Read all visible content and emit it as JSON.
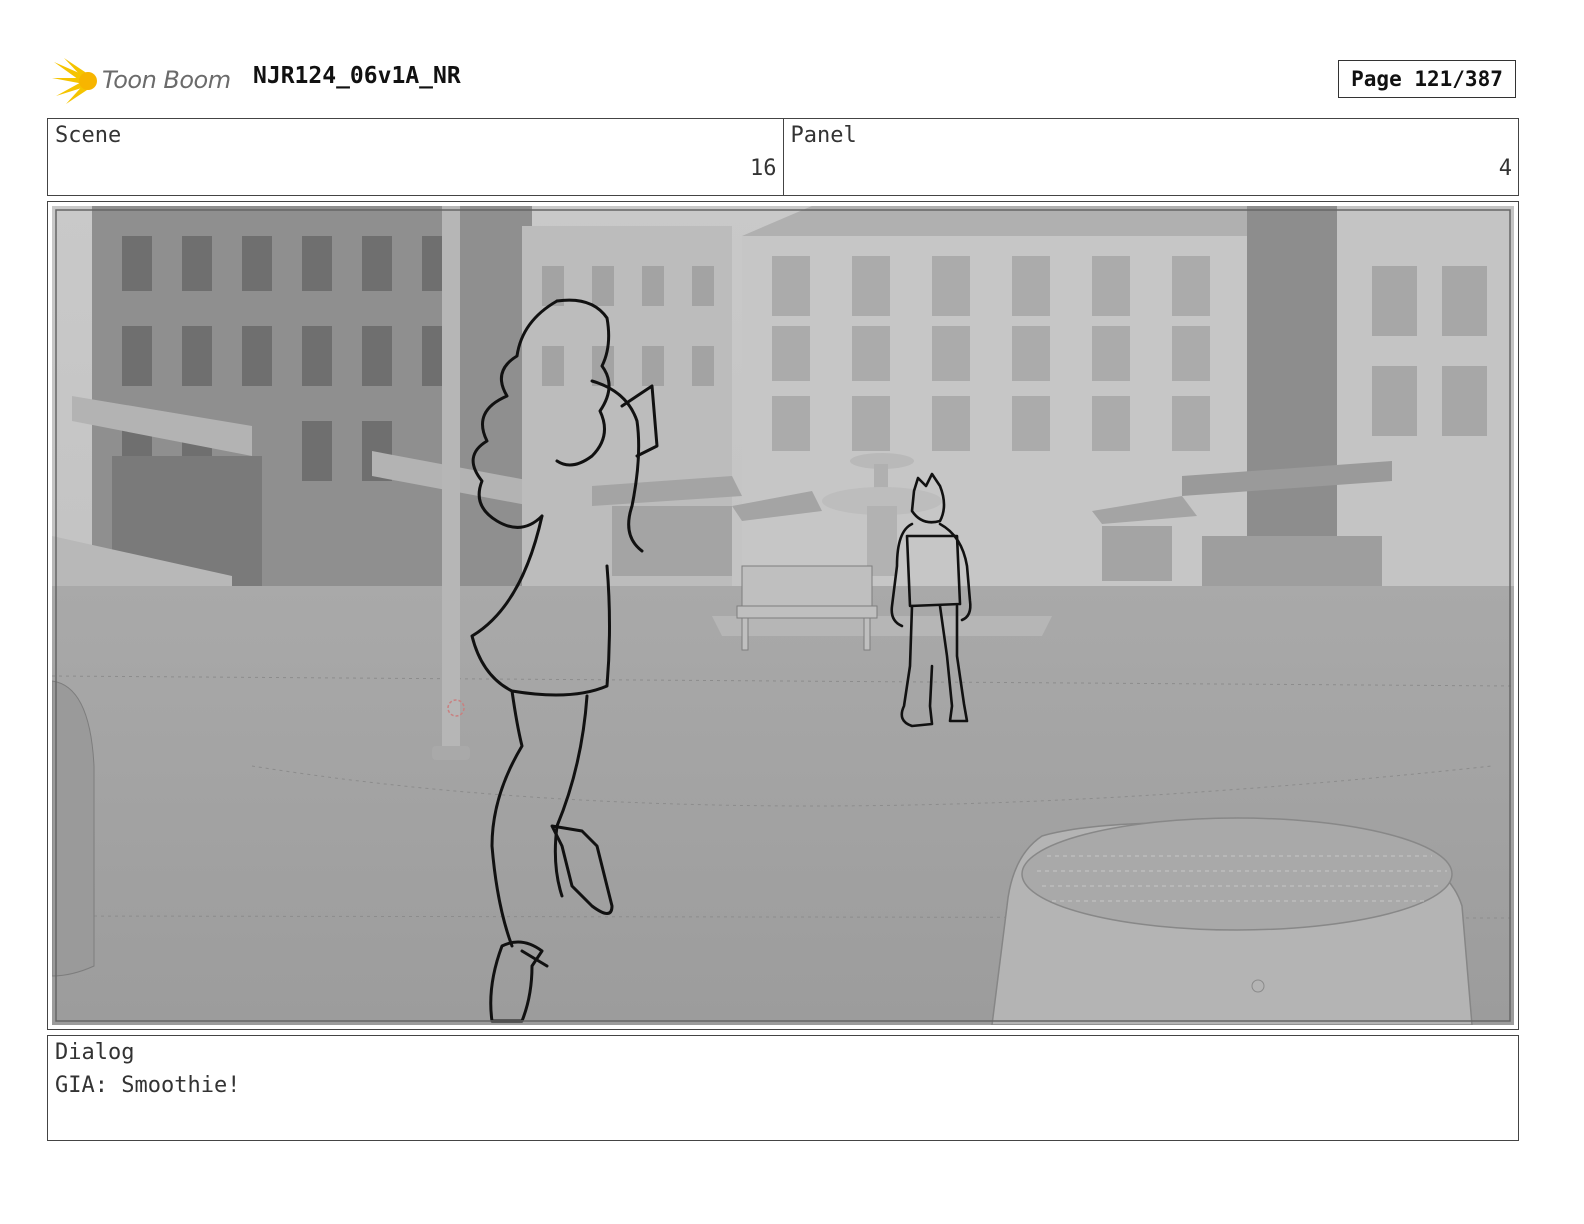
{
  "header": {
    "logo_text": "Toon Boom",
    "doc_title": "NJR124_06v1A_NR",
    "page_label": "Page 121/387"
  },
  "info": {
    "scene_label": "Scene",
    "scene_value": "16",
    "panel_label": "Panel",
    "panel_value": "4"
  },
  "dialog": {
    "label": "Dialog",
    "text": "GIA: Smoothie!"
  },
  "colors": {
    "logo_accent": "#f5c400",
    "sketch_line": "#111111",
    "render_gray": "#a6a6a6"
  }
}
